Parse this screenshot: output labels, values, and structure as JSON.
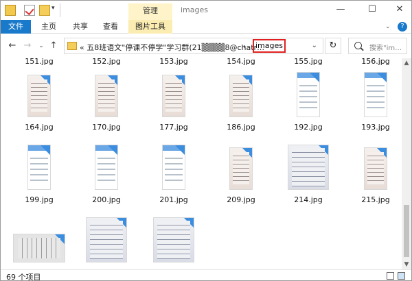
{
  "titlebar": {
    "context_tab": "管理",
    "window_title": "images",
    "controls": {
      "minimize": "—",
      "maximize": "☐",
      "close": "✕"
    }
  },
  "menus": [
    "文件",
    "主页",
    "共享",
    "查看",
    "图片工具"
  ],
  "address": {
    "path_text": "«  五8班语文\"停课不停学\"学习群(21▒▒▒▒8@chatr…",
    "separator": "›",
    "current_folder": "images",
    "search_placeholder": "搜索\"im…"
  },
  "files": [
    {
      "name": "151.jpg",
      "kind": "none"
    },
    {
      "name": "152.jpg",
      "kind": "none"
    },
    {
      "name": "153.jpg",
      "kind": "none"
    },
    {
      "name": "154.jpg",
      "kind": "none"
    },
    {
      "name": "155.jpg",
      "kind": "none"
    },
    {
      "name": "156.jpg",
      "kind": "none"
    },
    {
      "name": "164.jpg",
      "kind": "paper"
    },
    {
      "name": "170.jpg",
      "kind": "paper"
    },
    {
      "name": "177.jpg",
      "kind": "paper"
    },
    {
      "name": "186.jpg",
      "kind": "paper"
    },
    {
      "name": "192.jpg",
      "kind": "phone"
    },
    {
      "name": "193.jpg",
      "kind": "phone"
    },
    {
      "name": "199.jpg",
      "kind": "phone"
    },
    {
      "name": "200.jpg",
      "kind": "phone"
    },
    {
      "name": "201.jpg",
      "kind": "phone"
    },
    {
      "name": "209.jpg",
      "kind": "paper"
    },
    {
      "name": "214.jpg",
      "kind": "notebook"
    },
    {
      "name": "215.jpg",
      "kind": "paper"
    },
    {
      "name": "",
      "kind": "rotated"
    },
    {
      "name": "",
      "kind": "notebook"
    },
    {
      "name": "",
      "kind": "notebook"
    }
  ],
  "status": {
    "count_text": "69 个项目"
  },
  "colors": {
    "accent": "#1979ca",
    "context_tab": "#fff4c9",
    "highlight_border": "#e02020"
  }
}
